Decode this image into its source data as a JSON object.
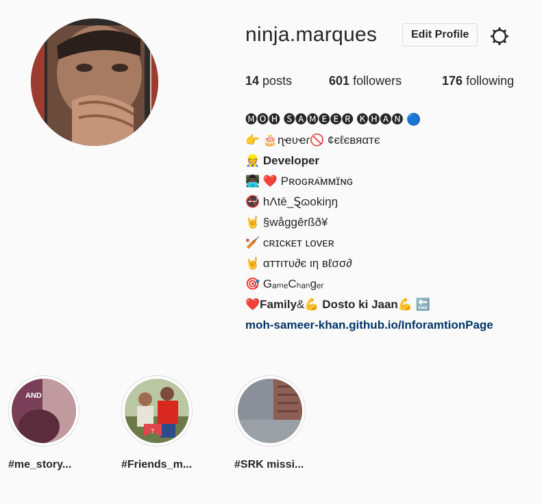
{
  "profile": {
    "username": "ninja.marques",
    "edit_label": "Edit Profile",
    "settings_icon": "gear-icon",
    "stats": {
      "posts_count": "14",
      "posts_label": "posts",
      "followers_count": "601",
      "followers_label": "followers",
      "following_count": "176",
      "following_label": "following"
    }
  },
  "bio": {
    "name": "🅜🅞🅗 🅢🅐🅜🅔🅔🅡 🅚🅗🅐🅝 🔵",
    "line1": "👉  🎂ɳҽʋҽɾ🚫 ¢єℓєвяαтє",
    "line2_emoji": "👷",
    "line2_text": "Developer",
    "line3": "👨🏿‍💻 ❤️ Pʀᴏɢʀᴀ̈ᴍᴍɪ̈ɴɢ",
    "line4": "🚭 hɅtē_Ȿɷokiŋŋ",
    "line5": "🤘 §wåggêrßð¥",
    "line6": "🏏 ᴄʀɪᴄᴋᴇᴛ ʟᴏᴠᴇʀ",
    "line7": "🤘 αттιтυ∂є ιη вℓσσ∂",
    "line8": "🎯 GₐₘₑCₕₐₙgₑᵣ",
    "line9_a": "❤️",
    "line9_b": "Family",
    "line9_c": "&💪",
    "line9_d": "Dosto ki Jaan",
    "line9_e": "💪 🔚",
    "link": "moh-sameer-khan.github.io/InforamtionPage"
  },
  "highlights": [
    {
      "label": "#me_story..."
    },
    {
      "label": "#Friends_m..."
    },
    {
      "label": "#SRK missi..."
    }
  ],
  "colors": {
    "link": "#003569",
    "border": "#dbdbdb",
    "background": "#fafafa"
  }
}
